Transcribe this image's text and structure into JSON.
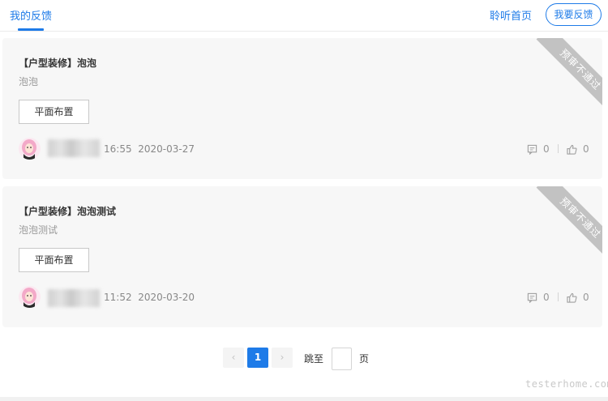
{
  "header": {
    "active_tab": "我的反馈",
    "home_link": "聆听首页",
    "feedback_button": "我要反馈"
  },
  "cards": [
    {
      "title": "【户型装修】泡泡",
      "subtitle": "泡泡",
      "tag": "平面布置",
      "time": "16:55",
      "date": "2020-03-27",
      "comments": "0",
      "likes": "0",
      "status_ribbon": "预审不通过"
    },
    {
      "title": "【户型装修】泡泡测试",
      "subtitle": "泡泡测试",
      "tag": "平面布置",
      "time": "11:52",
      "date": "2020-03-20",
      "comments": "0",
      "likes": "0",
      "status_ribbon": "预审不通过"
    }
  ],
  "pagination": {
    "prev": "‹",
    "current": "1",
    "next": "›",
    "goto_label": "跳至",
    "page_label": "页",
    "input_value": ""
  },
  "watermark": "testerhome.com",
  "colors": {
    "accent": "#1e7be8",
    "card_bg": "#f7f7f7",
    "ribbon": "#c2c2c2"
  },
  "icons": [
    "comment-icon",
    "thumbs-up-icon",
    "avatar"
  ]
}
